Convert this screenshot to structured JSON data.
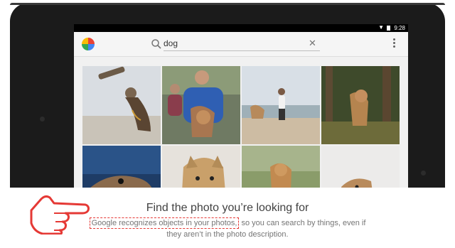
{
  "status_bar": {
    "time": "9:28"
  },
  "app_bar": {
    "search_value": "dog",
    "logo_icon": "photos-pinwheel-icon",
    "search_icon": "search-icon",
    "clear_icon": "close-icon",
    "menu_icon": "more-vert-icon"
  },
  "photos": [
    {
      "subject": "dog-catching-stick-beach"
    },
    {
      "subject": "man-hugging-dog"
    },
    {
      "subject": "dog-playing-beach"
    },
    {
      "subject": "dog-in-forest"
    },
    {
      "subject": "dog-closeup-blue"
    },
    {
      "subject": "dog-closeup-tan"
    },
    {
      "subject": "dog-in-field"
    },
    {
      "subject": "dog-head-white"
    }
  ],
  "caption": {
    "title": "Find the photo you’re looking for",
    "highlight": "Google recognizes objects in your photos,",
    "line1_rest": " so you can search by things, even if",
    "line2": "they aren’t in the photo description."
  },
  "colors": {
    "accent_red": "#e53935",
    "device": "#1b1b1b"
  }
}
